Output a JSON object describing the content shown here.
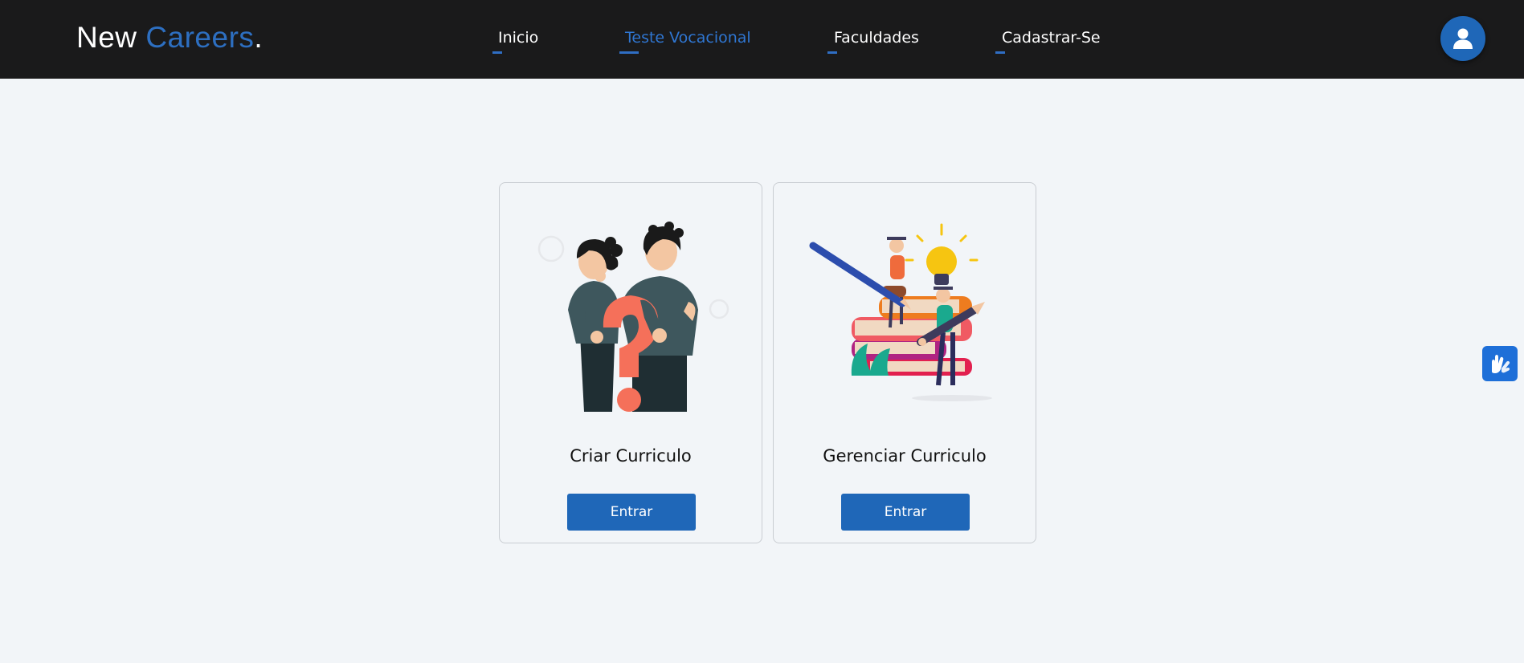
{
  "brand": {
    "part1": "New ",
    "part2": "Careers",
    "dot": "."
  },
  "nav": {
    "items": [
      {
        "label": "Inicio"
      },
      {
        "label": "Teste Vocacional"
      },
      {
        "label": "Faculdades"
      },
      {
        "label": "Cadastrar-Se"
      }
    ],
    "active": "Teste Vocacional"
  },
  "header": {
    "avatar_icon": "user-icon"
  },
  "cards": [
    {
      "title": "Criar Curriculo",
      "button_label": "Entrar",
      "illustration": "thinking-people-question-mark"
    },
    {
      "title": "Gerenciar Curriculo",
      "button_label": "Entrar",
      "illustration": "students-books-lightbulb"
    }
  ],
  "accessibility": {
    "icon": "sign-language-hands-icon"
  },
  "colors": {
    "navbar_bg": "#1a1a1b",
    "accent": "#2d6fc1",
    "button": "#1f67b8",
    "page_bg": "#f2f5f8"
  }
}
